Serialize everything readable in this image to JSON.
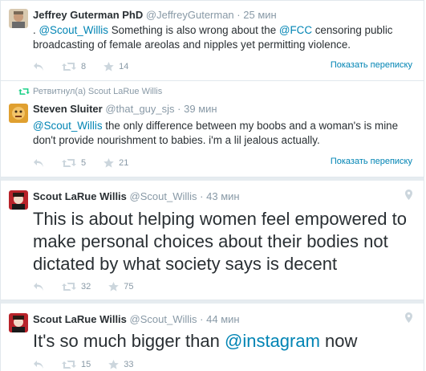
{
  "tweets": [
    {
      "fullname": "Jeffrey Guterman PhD",
      "username": "@JeffreyGuterman",
      "dot": "·",
      "time": "25 мин",
      "text_prefix": ". ",
      "mention1": "@Scout_Willis",
      "text_mid": " Something is also wrong about the ",
      "mention2": "@FCC",
      "text_suffix": " censoring public broadcasting of female areolas and nipples yet permitting violence.",
      "retweets": "8",
      "favorites": "14",
      "conversation": "Показать переписку"
    },
    {
      "retweeted_by": "Ретвитнул(а) Scout LaRue Willis",
      "fullname": "Steven Sluiter",
      "username": "@that_guy_sjs",
      "dot": "·",
      "time": "39 мин",
      "mention1": "@Scout_Willis",
      "text_suffix": " the only difference between my boobs and a woman's is mine don't provide nourishment to babies. i'm a lil jealous actually.",
      "retweets": "5",
      "favorites": "21",
      "conversation": "Показать переписку"
    },
    {
      "fullname": "Scout LaRue Willis",
      "username": "@Scout_Willis",
      "dot": "·",
      "time": "43 мин",
      "text": "This is about helping women feel empowered to make personal choices about their bodies not dictated by what society says is decent",
      "retweets": "32",
      "favorites": "75"
    },
    {
      "fullname": "Scout LaRue Willis",
      "username": "@Scout_Willis",
      "dot": "·",
      "time": "44 мин",
      "text_prefix": "It's so much bigger than ",
      "mention1": "@instagram",
      "text_suffix": " now",
      "retweets": "15",
      "favorites": "33"
    }
  ],
  "icons": [
    "reply-icon",
    "retweet-icon",
    "favorite-icon",
    "location-pin-icon"
  ],
  "colors": {
    "link": "#0084b4",
    "muted": "#8899a6",
    "text": "#292f33",
    "retweet_green": "#19cf86"
  }
}
